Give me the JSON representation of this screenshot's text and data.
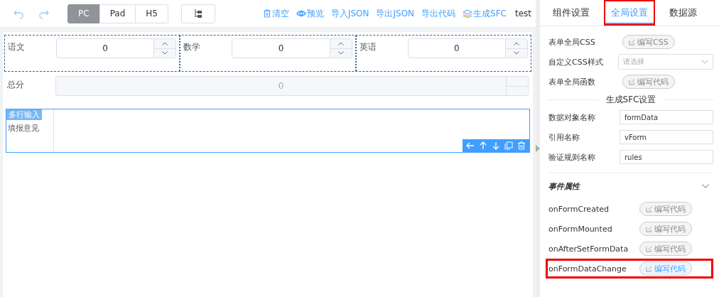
{
  "toolbar": {
    "devices": [
      {
        "label": "PC",
        "selected": true
      },
      {
        "label": "Pad",
        "selected": false
      },
      {
        "label": "H5",
        "selected": false
      }
    ],
    "actions": [
      {
        "label": "清空",
        "kind": "trash"
      },
      {
        "label": "预览",
        "kind": "eye"
      },
      {
        "label": "导入JSON",
        "kind": "plain"
      },
      {
        "label": "导出JSON",
        "kind": "plain"
      },
      {
        "label": "导出代码",
        "kind": "plain"
      },
      {
        "label": "生成SFC",
        "kind": "layers"
      }
    ],
    "extra": "test"
  },
  "form": {
    "grid": [
      {
        "label": "语文",
        "value": "0"
      },
      {
        "label": "数学",
        "value": "0"
      },
      {
        "label": "英语",
        "value": "0"
      }
    ],
    "total": {
      "label": "总分",
      "value": "0",
      "disabled": true
    },
    "textarea": {
      "badge": "多行输入",
      "label": "填报意见",
      "selected": true
    }
  },
  "panel": {
    "tabs": [
      {
        "label": "组件设置",
        "selected": false,
        "highlighted": false
      },
      {
        "label": "全局设置",
        "selected": true,
        "highlighted": true
      },
      {
        "label": "数据源",
        "selected": false,
        "highlighted": false
      }
    ],
    "settings": [
      {
        "kind": "button",
        "label": "表单全局CSS",
        "button": "编写CSS"
      },
      {
        "kind": "select",
        "label": "自定义CSS样式",
        "placeholder": "请选择"
      },
      {
        "kind": "button",
        "label": "表单全局函数",
        "button": "编写代码"
      }
    ],
    "sfc_title": "生成SFC设置",
    "sfc_fields": [
      {
        "label": "数据对象名称",
        "value": "formData"
      },
      {
        "label": "引用名称",
        "value": "vForm"
      },
      {
        "label": "验证规则名称",
        "value": "rules"
      }
    ],
    "events_title": "事件属性",
    "events_expanded": true,
    "events": [
      {
        "name": "onFormCreated",
        "button": "编写代码",
        "highlighted": false
      },
      {
        "name": "onFormMounted",
        "button": "编写代码",
        "highlighted": false
      },
      {
        "name": "onAfterSetFormData",
        "button": "编写代码",
        "highlighted": false
      },
      {
        "name": "onFormDataChange",
        "button": "编写代码",
        "highlighted": true
      }
    ]
  }
}
